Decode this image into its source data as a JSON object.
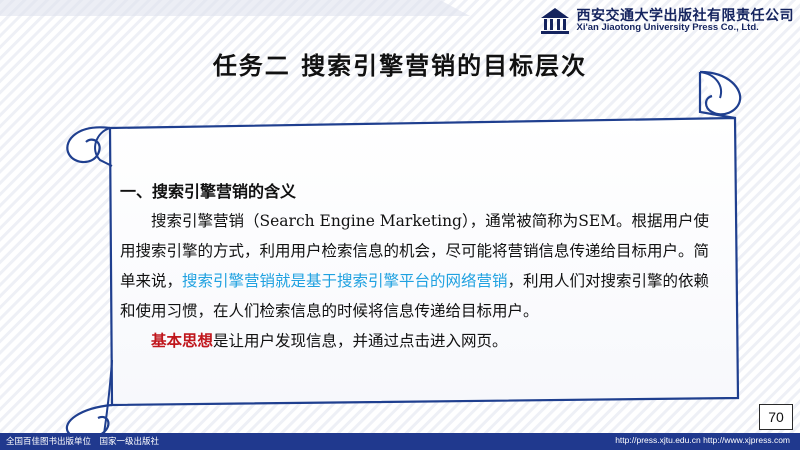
{
  "header": {
    "publisher_cn": "西安交通大学出版社有限责任公司",
    "publisher_en": "Xi'an Jiaotong University Press Co., Ltd.",
    "logo_icon": "university-emblem-icon"
  },
  "slide": {
    "title": "任务二 搜索引擎营销的目标层次",
    "section_heading": "一、搜索引擎营销的含义",
    "para1_part1": "搜索引擎营销（Search Engine Marketing），通常被简称为SEM。根据用户使用搜索引擎的方式，利用用户检索信息的机会，尽可能将营销信息传递给目标用户。简单来说，",
    "para1_highlight": "搜索引擎营销就是基于搜索引擎平台的网络营销",
    "para1_part2": "，利用人们对搜索引擎的依赖和使用习惯，在人们检索信息的时候将信息传递给目标用户。",
    "para2_highlight": "基本思想",
    "para2_rest": "是让用户发现信息，并通过点击进入网页。",
    "page_number": "70"
  },
  "footer": {
    "left": "全国百佳图书出版单位　国家一级出版社",
    "right": "http://press.xjtu.edu.cn  http://www.xjpress.com"
  },
  "colors": {
    "navy": "#20398e",
    "highlight_blue": "#1fa1e0",
    "highlight_red": "#c0161c",
    "scroll_border": "#1f3f8f"
  }
}
